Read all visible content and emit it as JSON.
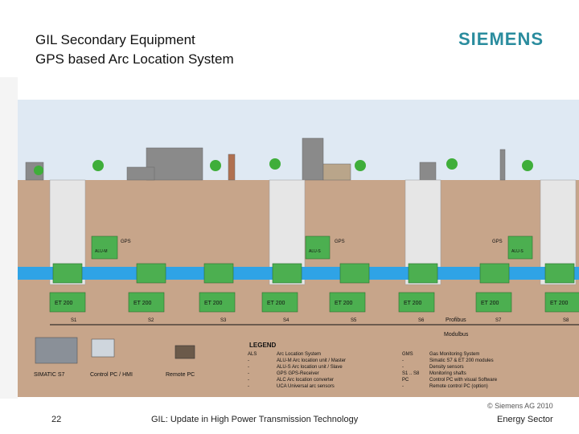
{
  "header": {
    "title_line1": "GIL Secondary Equipment",
    "title_line2": "GPS based Arc Location System",
    "brand": "SIEMENS"
  },
  "diagram": {
    "gps_labels": [
      "GPS",
      "GPS",
      "GPS"
    ],
    "alu_labels": [
      "ALU-M",
      "ALU-S",
      "ALU-S"
    ],
    "field_units": [
      "ET 200",
      "ET 200",
      "ET 200",
      "ET 200",
      "ET 200",
      "ET 200",
      "ET 200",
      "ET 200"
    ],
    "section_labels": [
      "S1",
      "S2",
      "S3",
      "S4",
      "S5",
      "S6",
      "S7",
      "S8"
    ],
    "bus_labels": {
      "profibus": "Profibus",
      "modulbus": "Modulbus"
    },
    "device_labels": {
      "simatic": "SIMATIC S7",
      "control_pc": "Control PC / HMI",
      "remote_pc": "Remote PC"
    },
    "legend": {
      "title": "LEGEND",
      "left": [
        {
          "key": "ALS",
          "value": "Arc Location System"
        },
        {
          "key": "-",
          "value": "ALU-M  Arc location unit / Master"
        },
        {
          "key": "-",
          "value": "ALU-S  Arc location unit / Slave"
        },
        {
          "key": "-",
          "value": "GPS  GPS-Receiver"
        },
        {
          "key": "-",
          "value": "ALC  Arc location converter"
        },
        {
          "key": "-",
          "value": "UCA  Universal arc sensors"
        }
      ],
      "right": [
        {
          "key": "GMS",
          "value": "Gas Monitoring System"
        },
        {
          "key": "-",
          "value": "Simatic S7 & ET 200 modules"
        },
        {
          "key": "-",
          "value": "Density sensors"
        },
        {
          "key": "S1 .. S8",
          "value": "Monitoring shafts"
        },
        {
          "key": "PC",
          "value": "Control PC with visual Software"
        },
        {
          "key": "-",
          "value": "Remote control PC (option)"
        }
      ]
    }
  },
  "footer": {
    "page_number": "22",
    "title": "GIL: Update in High Power Transmission Technology",
    "copyright": "© Siemens AG 2010",
    "sector": "Energy Sector"
  },
  "colors": {
    "sky": "#dfe9f3",
    "ground": "#c7a58a",
    "shaft": "#e6e6e6",
    "pipe": "#2fa3e6",
    "unit": "#4caf50",
    "brand": "#2a8c9e"
  }
}
